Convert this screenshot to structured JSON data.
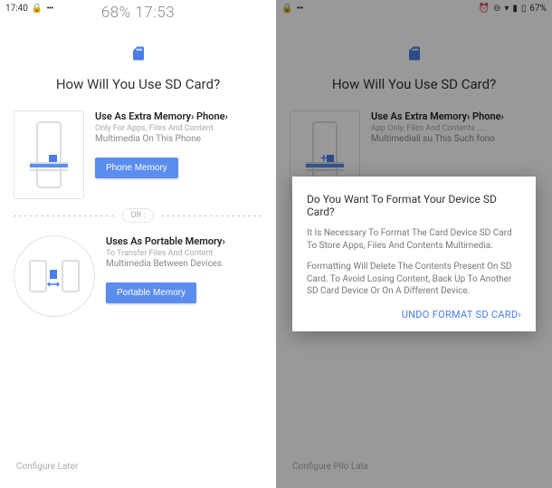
{
  "left": {
    "status": {
      "time": "17:40",
      "center_time": "68% 17:53"
    },
    "title": "How Will You Use SD Card?",
    "option1": {
      "title": "Use As Extra Memory› Phone›",
      "sub": "Only For Apps, Files And Content",
      "desc": "Multimedia On This Phone",
      "button": "Phone Memory"
    },
    "divider": "OR :",
    "option2": {
      "title": "Uses As Portable Memory›",
      "sub": "To Transfer Files And Content",
      "desc": "Multimedia Between Devices",
      "button": "Portable Memory"
    },
    "footer": "Configure Later"
  },
  "right": {
    "status": {
      "battery": "67%"
    },
    "title": "How Will You Use SD Card?",
    "option1": {
      "title": "Use As Extra Memory› Phone›",
      "sub": "App Only, Files And Contents ....",
      "desc": "Multimediali su This Such fono"
    },
    "footer": "Configure Pilo Late",
    "dialog": {
      "title": "Do You Want To Format Your Device SD Card?",
      "text1": "It Is Necessary To Format The Card Device SD Card To Store Apps, Files And Contents Multimedia.",
      "text2": "Formatting Will Delete The Contents Present On SD Card. To Avoid Losing Content, Back Up To Another SD Card Device Or On A Different Device.",
      "action": "UNDO FORMAT SD CARD›"
    }
  }
}
